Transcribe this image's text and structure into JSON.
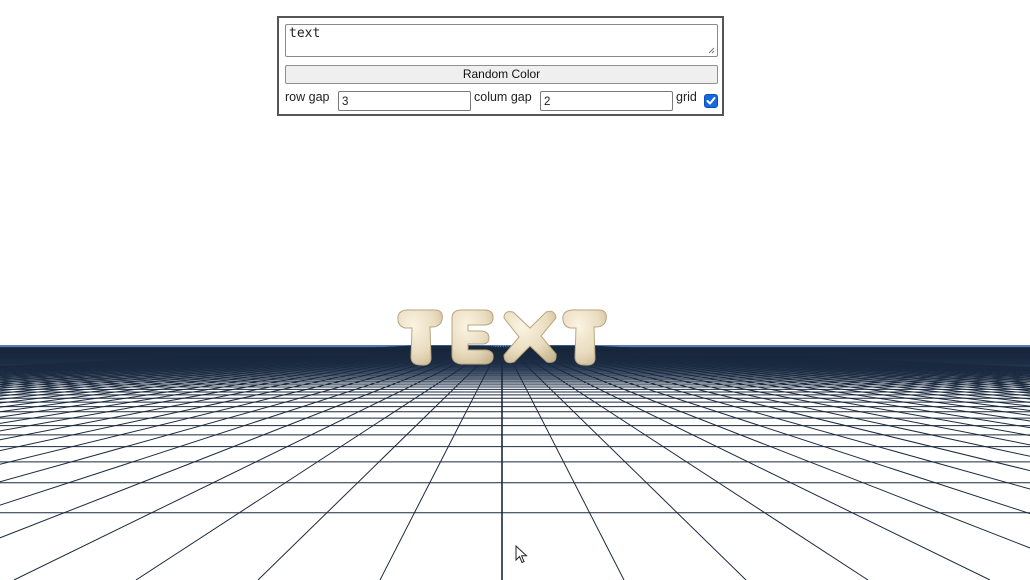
{
  "controls": {
    "text_value": "text",
    "random_color_label": "Random Color",
    "row_gap_label": "row gap",
    "row_gap_value": "3",
    "column_gap_label": "colum gap",
    "column_gap_value": "2",
    "grid_label": "grid",
    "grid_checked": true
  },
  "scene": {
    "letters": [
      "T",
      "E",
      "X",
      "T"
    ],
    "letter_color": "#e9dcbf",
    "sky_color": "#ffffff",
    "horizon_color": "#3d5f96",
    "grid_line_color": "#1b2a3f",
    "accent_checkbox": "#1769e0"
  }
}
